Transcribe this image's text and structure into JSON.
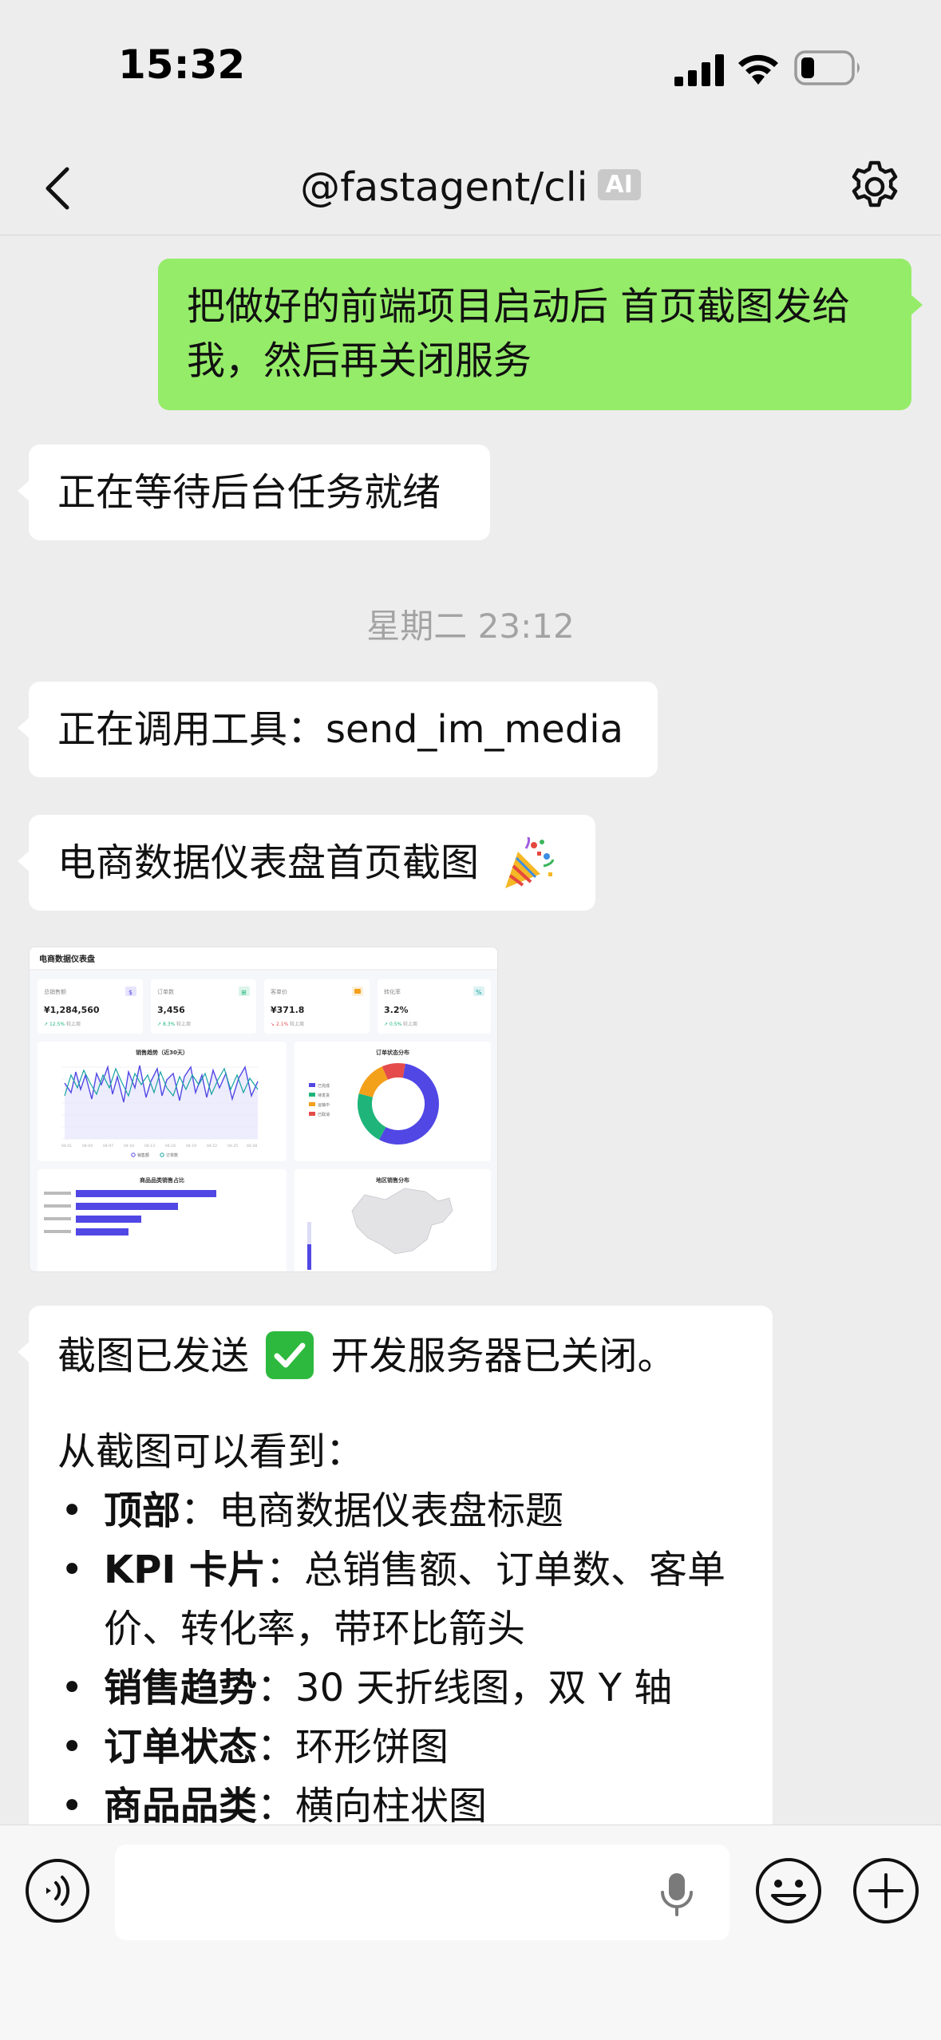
{
  "status_bar": {
    "time": "15:32"
  },
  "nav": {
    "title": "@fastagent/cli",
    "badge": "AI"
  },
  "messages": {
    "user_request_line1": "把做好的前端项目启动后 首页截图发给",
    "user_request_line2": "我，然后再关闭服务",
    "waiting": "正在等待后台任务就绪",
    "timestamp": "星期二 23:12",
    "tool_call": "正在调用工具：send_im_media",
    "caption": "电商数据仪表盘首页截图"
  },
  "thumbnail": {
    "header": "电商数据仪表盘",
    "kpis": [
      {
        "label": "总销售额",
        "value": "¥1,284,560",
        "change": "12.5%",
        "trend": "up"
      },
      {
        "label": "订单数",
        "value": "3,456",
        "change": "8.3%",
        "trend": "up"
      },
      {
        "label": "客单价",
        "value": "¥371.8",
        "change": "2.1%",
        "trend": "down"
      },
      {
        "label": "转化率",
        "value": "3.2%",
        "change": "0.5%",
        "trend": "up"
      }
    ],
    "compare_text": "较上周",
    "panels": {
      "sales_trend": "销售趋势（近30天）",
      "order_status": "订单状态分布",
      "category": "商品品类销售占比",
      "region": "地区销售分布"
    },
    "legend_sales": "销售额",
    "legend_orders": "订单数",
    "donut_legend": [
      "已完成",
      "待发货",
      "运输中",
      "已取消"
    ]
  },
  "summary": {
    "sent_prefix": "截图已发送",
    "sent_suffix": "开发服务器已关闭。",
    "intro": "从截图可以看到：",
    "bullet_marker": "•",
    "items": [
      {
        "title": "顶部",
        "sep": "：",
        "text": "电商数据仪表盘标题"
      },
      {
        "title": "KPI 卡片",
        "sep": "：",
        "text": "总销售额、订单数、客单价、转化率，带环比箭头"
      },
      {
        "title": "销售趋势",
        "sep": "：",
        "text": "30 天折线图，双 Y 轴"
      },
      {
        "title": "订单状态",
        "sep": "：",
        "text": "环形饼图"
      },
      {
        "title": "商品品类",
        "sep": "：",
        "text": "横向柱状图"
      }
    ]
  },
  "input_bar": {
    "placeholder": ""
  },
  "colors": {
    "outgoing_bubble": "#95ec69",
    "incoming_bubble": "#ffffff",
    "background": "#ededed",
    "check_green": "#2db93e",
    "chart_indigo": "#5147e5",
    "chart_green": "#1fb57a",
    "chart_orange": "#f3a01a",
    "chart_red": "#e54b4b"
  }
}
